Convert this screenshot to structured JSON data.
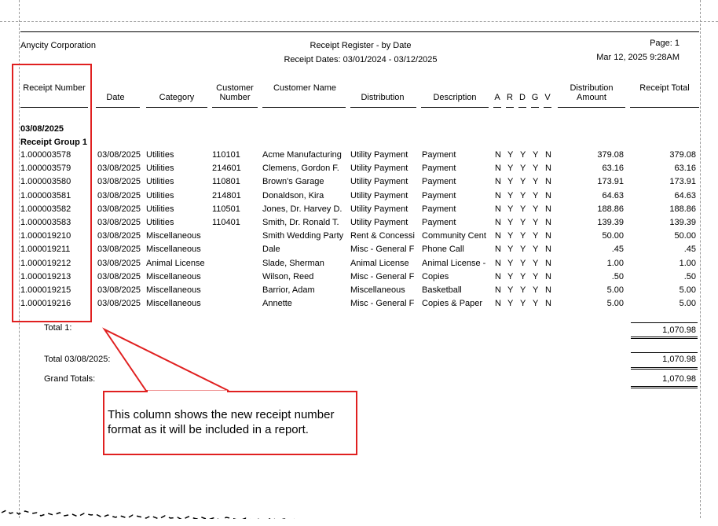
{
  "report": {
    "company": "Anycity Corporation",
    "title": "Receipt Register - by Date",
    "subtitle": "Receipt Dates: 03/01/2024 - 03/12/2025",
    "page": "Page: 1",
    "run_datetime": "Mar 12, 2025 9:28AM"
  },
  "columns": {
    "receipt_number": "Receipt Number",
    "date": "Date",
    "category": "Category",
    "customer_number": "Customer Number",
    "customer_name": "Customer Name",
    "distribution": "Distribution",
    "description": "Description",
    "a": "A",
    "r": "R",
    "d": "D",
    "g": "G",
    "v": "V",
    "distribution_amount": "Distribution Amount",
    "receipt_total": "Receipt Total"
  },
  "group": {
    "date_heading": "03/08/2025",
    "group_heading": "Receipt Group 1"
  },
  "rows": [
    {
      "receipt": "1.000003578",
      "date": "03/08/2025",
      "category": "Utilities",
      "cust_no": "110101",
      "cust_name": "Acme Manufacturing",
      "distribution": "Utility Payment",
      "description": "Payment",
      "a": "N",
      "r": "Y",
      "d": "Y",
      "g": "Y",
      "v": "N",
      "amount": "379.08",
      "total": "379.08"
    },
    {
      "receipt": "1.000003579",
      "date": "03/08/2025",
      "category": "Utilities",
      "cust_no": "214601",
      "cust_name": "Clemens, Gordon F.",
      "distribution": "Utility Payment",
      "description": "Payment",
      "a": "N",
      "r": "Y",
      "d": "Y",
      "g": "Y",
      "v": "N",
      "amount": "63.16",
      "total": "63.16"
    },
    {
      "receipt": "1.000003580",
      "date": "03/08/2025",
      "category": "Utilities",
      "cust_no": "110801",
      "cust_name": "Brown's Garage",
      "distribution": "Utility Payment",
      "description": "Payment",
      "a": "N",
      "r": "Y",
      "d": "Y",
      "g": "Y",
      "v": "N",
      "amount": "173.91",
      "total": "173.91"
    },
    {
      "receipt": "1.000003581",
      "date": "03/08/2025",
      "category": "Utilities",
      "cust_no": "214801",
      "cust_name": "Donaldson, Kira",
      "distribution": "Utility Payment",
      "description": "Payment",
      "a": "N",
      "r": "Y",
      "d": "Y",
      "g": "Y",
      "v": "N",
      "amount": "64.63",
      "total": "64.63"
    },
    {
      "receipt": "1.000003582",
      "date": "03/08/2025",
      "category": "Utilities",
      "cust_no": "110501",
      "cust_name": "Jones, Dr. Harvey D.",
      "distribution": "Utility Payment",
      "description": "Payment",
      "a": "N",
      "r": "Y",
      "d": "Y",
      "g": "Y",
      "v": "N",
      "amount": "188.86",
      "total": "188.86"
    },
    {
      "receipt": "1.000003583",
      "date": "03/08/2025",
      "category": "Utilities",
      "cust_no": "110401",
      "cust_name": "Smith, Dr. Ronald T.",
      "distribution": "Utility Payment",
      "description": "Payment",
      "a": "N",
      "r": "Y",
      "d": "Y",
      "g": "Y",
      "v": "N",
      "amount": "139.39",
      "total": "139.39"
    },
    {
      "receipt": "1.000019210",
      "date": "03/08/2025",
      "category": "Miscellaneous",
      "cust_no": "",
      "cust_name": "Smith Wedding Party",
      "distribution": "Rent & Concessi",
      "description": "Community Cent",
      "a": "N",
      "r": "Y",
      "d": "Y",
      "g": "Y",
      "v": "N",
      "amount": "50.00",
      "total": "50.00"
    },
    {
      "receipt": "1.000019211",
      "date": "03/08/2025",
      "category": "Miscellaneous",
      "cust_no": "",
      "cust_name": "Dale",
      "distribution": "Misc - General F",
      "description": "Phone Call",
      "a": "N",
      "r": "Y",
      "d": "Y",
      "g": "Y",
      "v": "N",
      "amount": ".45",
      "total": ".45"
    },
    {
      "receipt": "1.000019212",
      "date": "03/08/2025",
      "category": "Animal License",
      "cust_no": "",
      "cust_name": "Slade, Sherman",
      "distribution": "Animal License",
      "description": "Animal License -",
      "a": "N",
      "r": "Y",
      "d": "Y",
      "g": "Y",
      "v": "N",
      "amount": "1.00",
      "total": "1.00"
    },
    {
      "receipt": "1.000019213",
      "date": "03/08/2025",
      "category": "Miscellaneous",
      "cust_no": "",
      "cust_name": "Wilson, Reed",
      "distribution": "Misc - General F",
      "description": "Copies",
      "a": "N",
      "r": "Y",
      "d": "Y",
      "g": "Y",
      "v": "N",
      "amount": ".50",
      "total": ".50"
    },
    {
      "receipt": "1.000019215",
      "date": "03/08/2025",
      "category": "Miscellaneous",
      "cust_no": "",
      "cust_name": "Barrior, Adam",
      "distribution": "Miscellaneous",
      "description": "Basketball",
      "a": "N",
      "r": "Y",
      "d": "Y",
      "g": "Y",
      "v": "N",
      "amount": "5.00",
      "total": "5.00"
    },
    {
      "receipt": "1.000019216",
      "date": "03/08/2025",
      "category": "Miscellaneous",
      "cust_no": "",
      "cust_name": "Annette",
      "distribution": "Misc - General F",
      "description": "Copies & Paper",
      "a": "N",
      "r": "Y",
      "d": "Y",
      "g": "Y",
      "v": "N",
      "amount": "5.00",
      "total": "5.00"
    }
  ],
  "totals": {
    "total1_label": "Total 1:",
    "total1_value": "1,070.98",
    "date_total_label": "Total 03/08/2025:",
    "date_total_value": "1,070.98",
    "grand_label": "Grand Totals:",
    "grand_value": "1,070.98"
  },
  "annotation": {
    "text": "This column shows the new receipt number format as it will be included in a report.",
    "color": "#e02020"
  }
}
